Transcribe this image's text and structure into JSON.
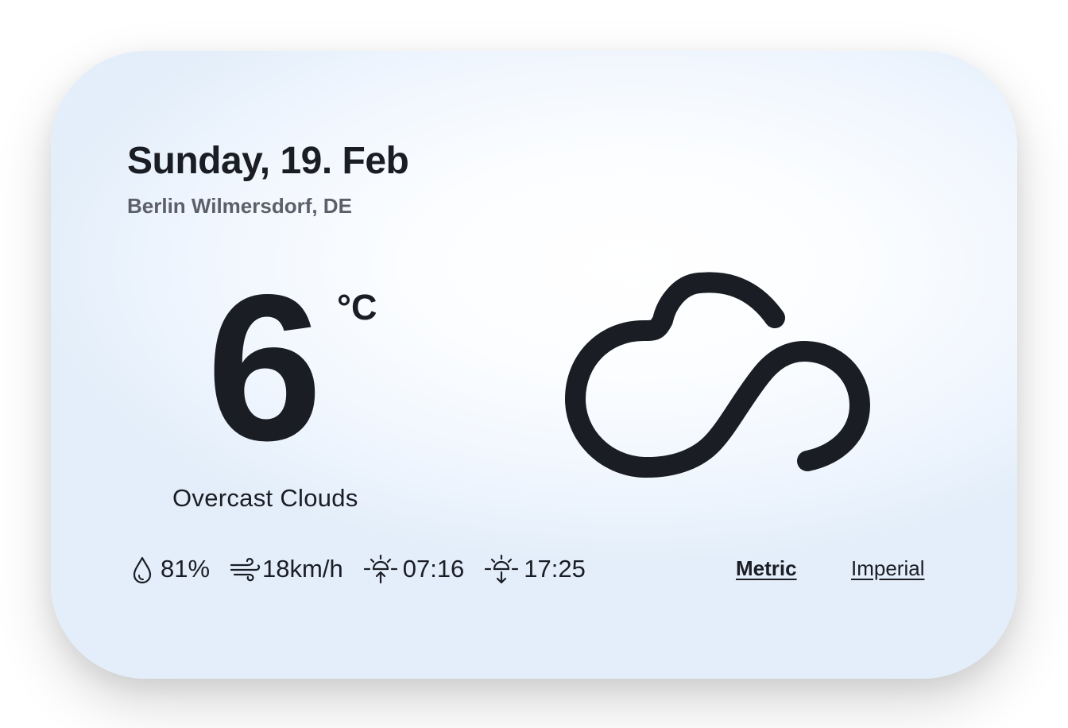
{
  "header": {
    "date": "Sunday, 19. Feb",
    "location": "Berlin Wilmersdorf, DE"
  },
  "current": {
    "temperature": "6",
    "unit": "°C",
    "condition": "Overcast Clouds",
    "icon": "cloud-icon"
  },
  "details": {
    "humidity": "81%",
    "wind": "18km/h",
    "sunrise": "07:16",
    "sunset": "17:25",
    "icons": [
      "humidity-drop-icon",
      "wind-icon",
      "sunrise-icon",
      "sunset-icon"
    ]
  },
  "unit_toggle": {
    "metric_label": "Metric",
    "imperial_label": "Imperial",
    "selected": "Metric"
  },
  "colors": {
    "text": "#1b1d24",
    "muted": "#5c5f69",
    "card_light": "#ffffff",
    "card_edge": "#e3eefa"
  }
}
